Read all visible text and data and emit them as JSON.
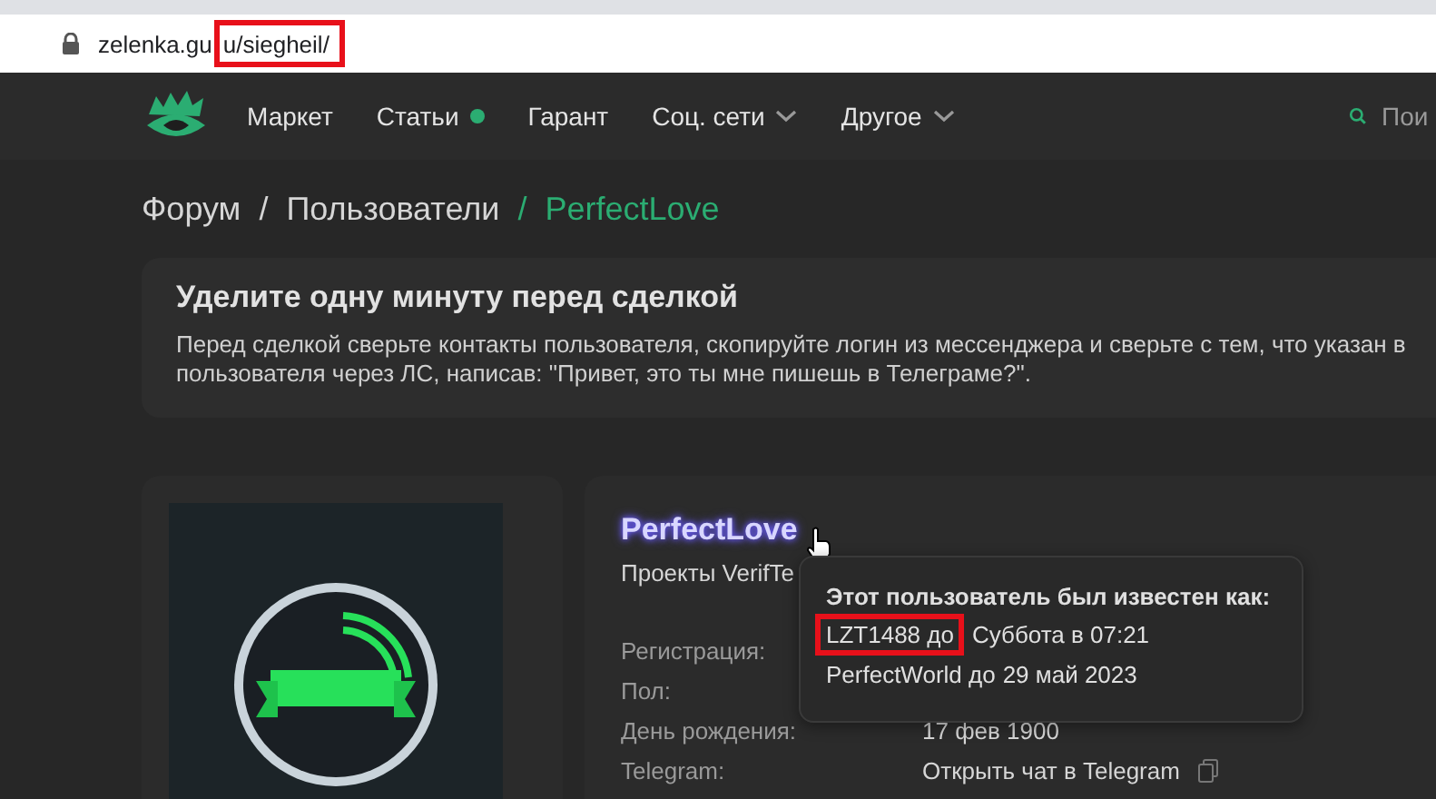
{
  "address_bar": {
    "host": "zelenka.gu",
    "path": "u/siegheil/",
    "path_highlighted": true
  },
  "nav": {
    "items": [
      {
        "label": "Маркет",
        "kind": "plain"
      },
      {
        "label": "Статьи",
        "kind": "dot"
      },
      {
        "label": "Гарант",
        "kind": "plain"
      },
      {
        "label": "Соц. сети",
        "kind": "dropdown"
      },
      {
        "label": "Другое",
        "kind": "dropdown"
      }
    ],
    "search": {
      "placeholder": "Пои"
    }
  },
  "breadcrumb": [
    {
      "label": "Форум",
      "selected": false
    },
    {
      "label": "Пользователи",
      "selected": false
    },
    {
      "label": "PerfectLove",
      "selected": true
    }
  ],
  "breadcrumb_separator": "/",
  "notice": {
    "title": "Уделите одну минуту перед сделкой",
    "text": "Перед сделкой сверьте контакты пользователя, скопируйте логин из мессенджера и сверьте с тем, что указан в пользователя через ЛС, написав: \"Привет, это ты мне пишешь в Телеграме?\"."
  },
  "profile": {
    "username": "PerfectLove",
    "subtitle": "Проекты VerifTe",
    "fields": [
      {
        "label": "Регистрация:"
      },
      {
        "label": "Пол:"
      },
      {
        "label": "День рождения:",
        "value": "17 фев 1900"
      },
      {
        "label": "Telegram:",
        "value": "Открыть чат в Telegram"
      }
    ]
  },
  "tooltip": {
    "title": "Этот пользователь был известен как:",
    "former_names": [
      {
        "name": "LZT1488 до",
        "date": "Суббота в 07:21",
        "highlighted": true
      },
      {
        "name": "PerfectWorld до",
        "date": "29 май 2023",
        "highlighted": false
      }
    ]
  }
}
